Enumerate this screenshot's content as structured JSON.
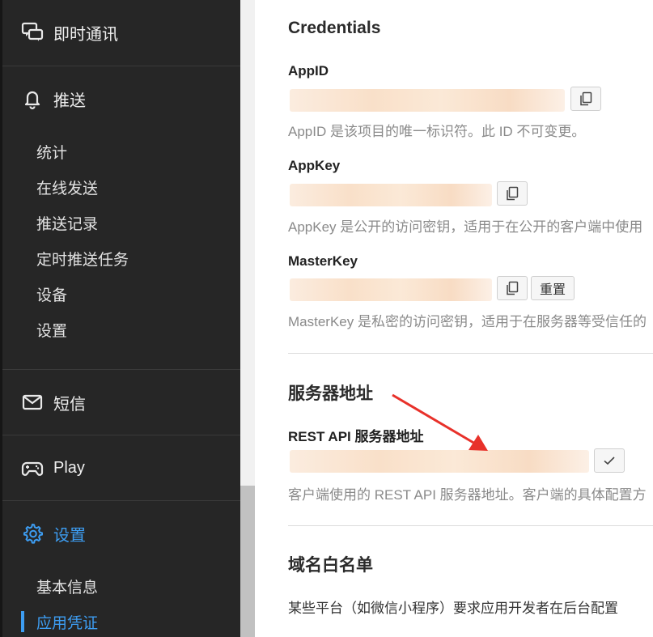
{
  "sidebar": {
    "im_label": "即时通讯",
    "push_label": "推送",
    "push_items": [
      "统计",
      "在线发送",
      "推送记录",
      "定时推送任务",
      "设备",
      "设置"
    ],
    "sms_label": "短信",
    "play_label": "Play",
    "settings_label": "设置",
    "settings_items": [
      "基本信息",
      "应用凭证"
    ],
    "accent_color": "#3d9df2"
  },
  "main": {
    "credentials_title": "Credentials",
    "appid_label": "AppID",
    "appid_help": "AppID 是该项目的唯一标识符。此 ID 不可变更。",
    "appkey_label": "AppKey",
    "appkey_help": "AppKey 是公开的访问密钥，适用于在公开的客户端中使用",
    "masterkey_label": "MasterKey",
    "masterkey_help": "MasterKey 是私密的访问密钥，适用于在服务器等受信任的",
    "reset_label": "重置",
    "server_title": "服务器地址",
    "rest_label": "REST API 服务器地址",
    "rest_help": "客户端使用的 REST API 服务器地址。客户端的具体配置方",
    "domain_title": "域名白名单",
    "domain_help": "某些平台（如微信小程序）要求应用开发者在后台配置"
  },
  "icons": {
    "copy": "copy-icon",
    "check": "check-icon",
    "annotation": "red-arrow"
  }
}
